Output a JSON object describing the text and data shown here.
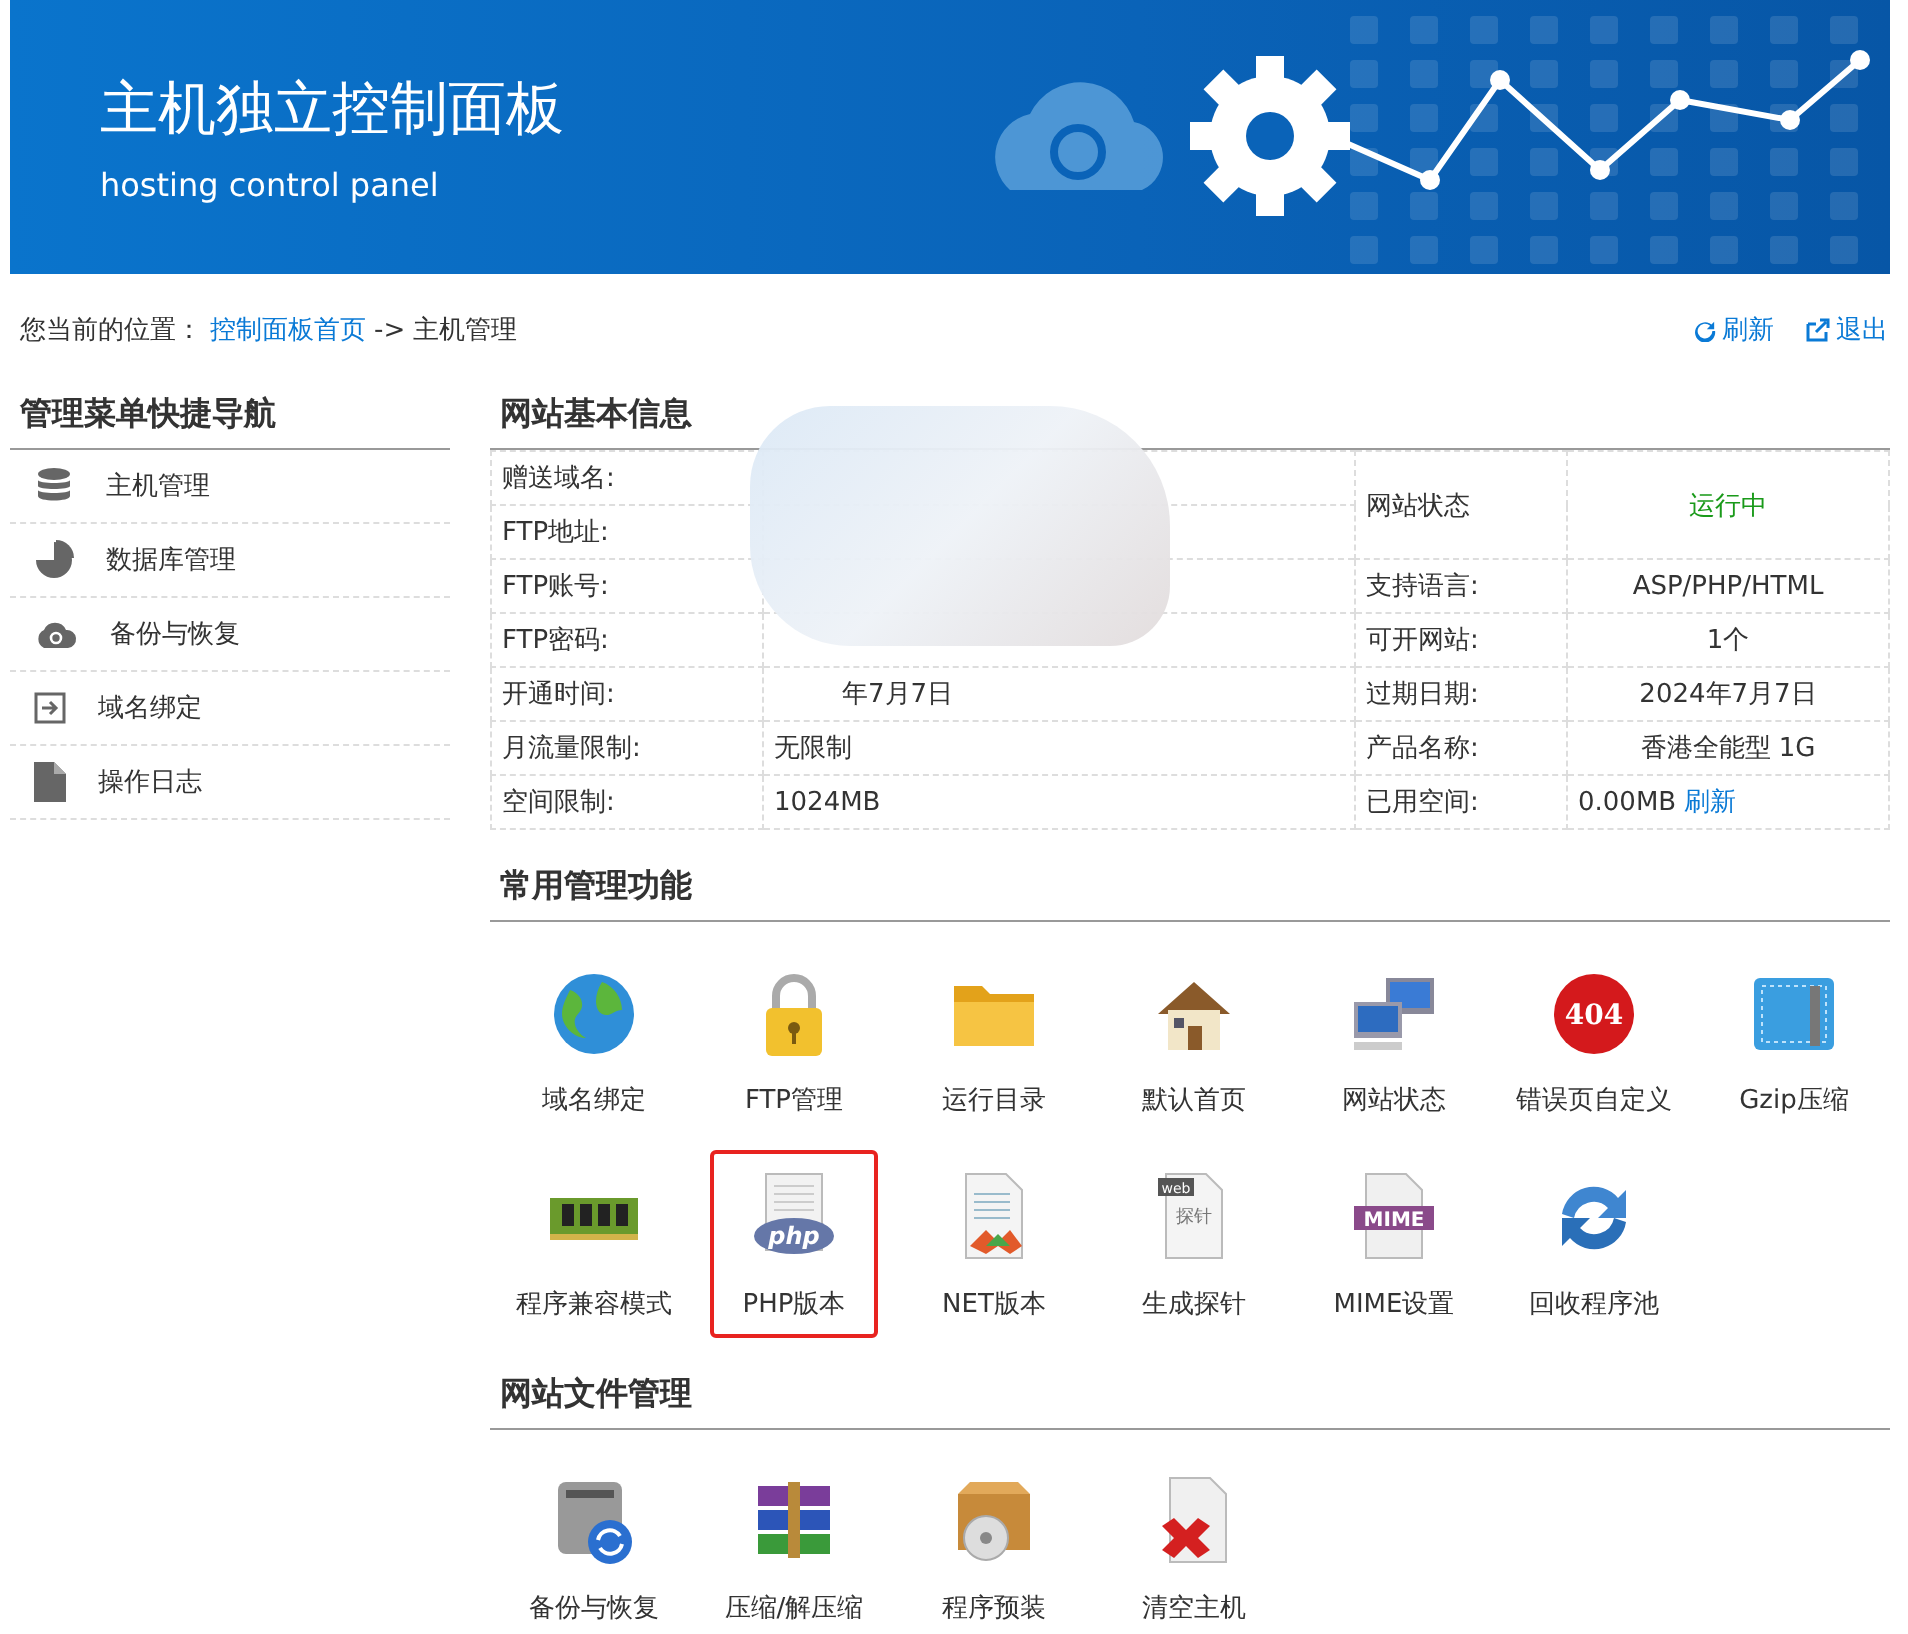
{
  "header": {
    "title": "主机独立控制面板",
    "subtitle": "hosting control panel"
  },
  "breadcrumb": {
    "prefix": "您当前的位置：",
    "home": "控制面板首页",
    "separator": "->",
    "current": "主机管理"
  },
  "actions": [
    {
      "kind": "refresh",
      "label": "刷新"
    },
    {
      "kind": "logout",
      "label": "退出"
    }
  ],
  "sidebar": {
    "title": "管理菜单快捷导航",
    "items": [
      {
        "kind": "database",
        "label": "主机管理"
      },
      {
        "kind": "pie",
        "label": "数据库管理"
      },
      {
        "kind": "cloud",
        "label": "备份与恢复"
      },
      {
        "kind": "enter",
        "label": "域名绑定"
      },
      {
        "kind": "file",
        "label": "操作日志"
      }
    ]
  },
  "info": {
    "title": "网站基本信息",
    "rows": [
      {
        "label": "赠送域名:",
        "value": "",
        "right_label": "网站状态",
        "right_value": "运行中",
        "kind": "status"
      },
      {
        "label": "FTP地址:",
        "value": "",
        "kind": "continued"
      },
      {
        "label": "FTP账号:",
        "value": "",
        "kind": "pair",
        "right_label": "支持语言:",
        "right_value": "ASP/PHP/HTML"
      },
      {
        "label": "FTP密码:",
        "value": "",
        "kind": "pair",
        "right_label": "可开网站:",
        "right_value": "1个"
      },
      {
        "label": "开通时间:",
        "value": "年7月7日",
        "kind": "pair",
        "right_label": "过期日期:",
        "right_value": "2024年7月7日"
      },
      {
        "label": "月流量限制:",
        "value": "无限制",
        "kind": "pair",
        "right_label": "产品名称:",
        "right_value": "香港全能型 1G"
      },
      {
        "label": "空间限制:",
        "value": "1024MB",
        "kind": "pair",
        "right_label": "已用空间:",
        "right_value": "0.00MB",
        "right_link": "刷新"
      }
    ]
  },
  "sections": [
    {
      "title": "常用管理功能",
      "items": [
        {
          "kind": "globe",
          "label": "域名绑定",
          "selected": false
        },
        {
          "kind": "lock",
          "label": "FTP管理",
          "selected": false
        },
        {
          "kind": "folder",
          "label": "运行目录",
          "selected": false
        },
        {
          "kind": "house",
          "label": "默认首页",
          "selected": false
        },
        {
          "kind": "computers",
          "label": "网站状态",
          "selected": false
        },
        {
          "kind": "badge",
          "label": "错误页自定义",
          "icon_text": "404",
          "selected": false
        },
        {
          "kind": "tool",
          "label": "Gzip压缩",
          "selected": false
        },
        {
          "kind": "memory",
          "label": "程序兼容模式",
          "selected": false
        },
        {
          "kind": "php",
          "label": "PHP版本",
          "icon_text": "php",
          "selected": true
        },
        {
          "kind": "net",
          "label": "NET版本",
          "selected": false
        },
        {
          "kind": "probe",
          "label": "生成探针",
          "icon_text": "web",
          "icon_text2": "探针",
          "selected": false
        },
        {
          "kind": "mime",
          "label": "MIME设置",
          "icon_text": "MIME",
          "selected": false
        },
        {
          "kind": "recycle",
          "label": "回收程序池",
          "selected": false
        }
      ]
    },
    {
      "title": "网站文件管理",
      "items": [
        {
          "kind": "disk",
          "label": "备份与恢复",
          "selected": false
        },
        {
          "kind": "archive",
          "label": "压缩/解压缩",
          "selected": false
        },
        {
          "kind": "box",
          "label": "程序预装",
          "selected": false
        },
        {
          "kind": "delete",
          "label": "清空主机",
          "selected": false
        }
      ]
    }
  ]
}
